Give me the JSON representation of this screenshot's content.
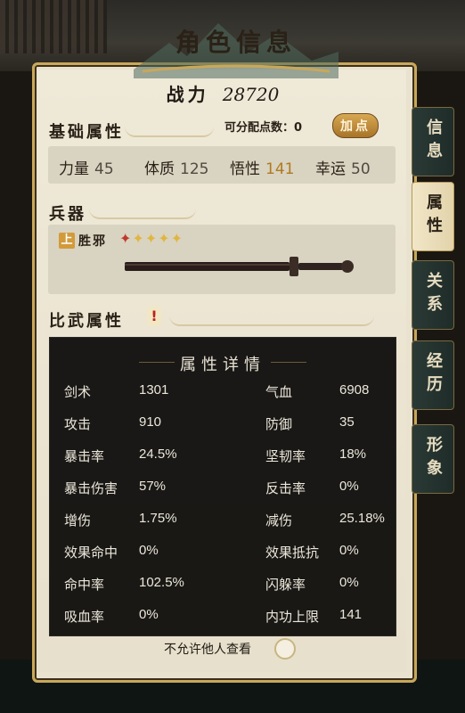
{
  "window": {
    "title": "角色信息"
  },
  "power": {
    "label": "战力",
    "value": "28720"
  },
  "basic": {
    "heading": "基础属性",
    "alloc_label": "可分配点数：0",
    "add_button": "加点",
    "stats": [
      {
        "label": "力量",
        "value": "45"
      },
      {
        "label": "体质",
        "value": "125"
      },
      {
        "label": "悟性",
        "value": "141"
      },
      {
        "label": "幸运",
        "value": "50"
      }
    ]
  },
  "weapon": {
    "heading": "兵器",
    "tier": "上",
    "name": "胜邪",
    "stars_red": 1,
    "stars_total": 5
  },
  "combat": {
    "heading": "比武属性",
    "hint": "!"
  },
  "overlay": {
    "title": "属性详情",
    "rows": [
      {
        "l1": "剑术",
        "v1": "1301",
        "l2": "气血",
        "v2": "6908"
      },
      {
        "l1": "攻击",
        "v1": "910",
        "l2": "防御",
        "v2": "35"
      },
      {
        "l1": "暴击率",
        "v1": "24.5%",
        "l2": "坚韧率",
        "v2": "18%"
      },
      {
        "l1": "暴击伤害",
        "v1": "57%",
        "l2": "反击率",
        "v2": "0%"
      },
      {
        "l1": "增伤",
        "v1": "1.75%",
        "l2": "减伤",
        "v2": "25.18%"
      },
      {
        "l1": "效果命中",
        "v1": "0%",
        "l2": "效果抵抗",
        "v2": "0%"
      },
      {
        "l1": "命中率",
        "v1": "102.5%",
        "l2": "闪躲率",
        "v2": "0%"
      },
      {
        "l1": "吸血率",
        "v1": "0%",
        "l2": "内功上限",
        "v2": "141"
      }
    ]
  },
  "hidden_option": {
    "label": "不允许他人查看"
  },
  "tabs": [
    "信息",
    "属性",
    "关系",
    "经历",
    "形象"
  ],
  "active_tab": "属性",
  "colors": {
    "gold": "#c9a85a",
    "highlight": "#b07a20",
    "dark": "#2a2117"
  }
}
